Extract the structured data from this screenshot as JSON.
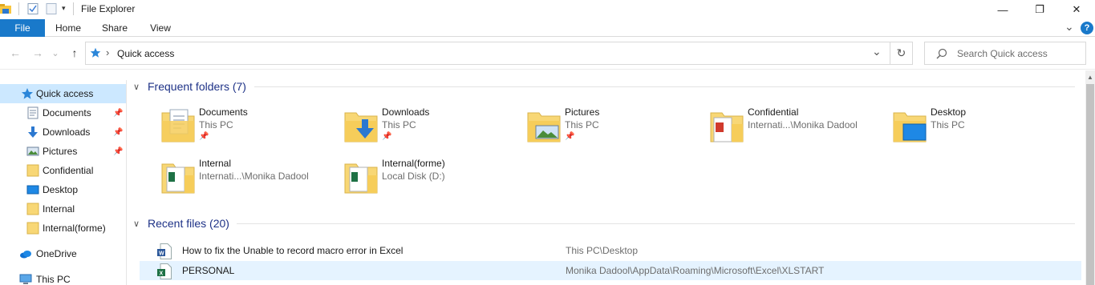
{
  "window": {
    "title": "File Explorer",
    "icons": {
      "app": "file-explorer-icon",
      "properties": "properties-icon",
      "new_folder": "new-folder-icon",
      "customize": "customize-qat-icon"
    },
    "controls": {
      "minimize": "—",
      "restore": "❐",
      "close": "✕"
    }
  },
  "ribbon": {
    "tabs": [
      {
        "label": "File"
      },
      {
        "label": "Home"
      },
      {
        "label": "Share"
      },
      {
        "label": "View"
      }
    ],
    "expand": "⌄",
    "help": "?"
  },
  "nav": {
    "back": "←",
    "forward": "→",
    "recent": "⌄",
    "up": "↑",
    "address_separator": "›",
    "address_text": "Quick access",
    "address_dropdown": "⌄",
    "refresh": "↻",
    "search_placeholder": "Search Quick access"
  },
  "sidebar": {
    "items": [
      {
        "label": "Quick access",
        "icon": "star-icon",
        "pinned": false,
        "selected": true
      },
      {
        "label": "Documents",
        "icon": "documents-folder-icon",
        "pinned": true
      },
      {
        "label": "Downloads",
        "icon": "downloads-icon",
        "pinned": true
      },
      {
        "label": "Pictures",
        "icon": "pictures-icon",
        "pinned": true
      },
      {
        "label": "Confidential",
        "icon": "folder-icon",
        "pinned": false
      },
      {
        "label": "Desktop",
        "icon": "desktop-icon",
        "pinned": false
      },
      {
        "label": "Internal",
        "icon": "folder-icon",
        "pinned": false
      },
      {
        "label": "Internal(forme)",
        "icon": "folder-icon",
        "pinned": false
      },
      {
        "label": "OneDrive",
        "icon": "onedrive-icon",
        "pinned": false
      },
      {
        "label": "This PC",
        "icon": "this-pc-icon",
        "pinned": false
      }
    ]
  },
  "frequent": {
    "heading": "Frequent folders (7)",
    "folders": [
      {
        "name": "Documents",
        "location": "This PC",
        "pinned": true
      },
      {
        "name": "Downloads",
        "location": "This PC",
        "pinned": true
      },
      {
        "name": "Pictures",
        "location": "This PC",
        "pinned": true
      },
      {
        "name": "Confidential",
        "location": "Internati...\\Monika Dadool",
        "pinned": false
      },
      {
        "name": "Desktop",
        "location": "This PC",
        "pinned": false
      },
      {
        "name": "Internal",
        "location": "Internati...\\Monika Dadool",
        "pinned": false
      },
      {
        "name": "Internal(forme)",
        "location": "Local Disk (D:)",
        "pinned": false
      }
    ]
  },
  "recent": {
    "heading": "Recent files (20)",
    "files": [
      {
        "name": "How to fix the Unable to record macro error in Excel",
        "path": "This PC\\Desktop",
        "type": "word"
      },
      {
        "name": "PERSONAL",
        "path": "Monika Dadool\\AppData\\Roaming\\Microsoft\\Excel\\XLSTART",
        "type": "excel"
      }
    ]
  },
  "colors": {
    "accent": "#1979ca",
    "section_heading": "#1e3287",
    "selected_bg": "#cce8ff",
    "folder_yellow": "#f8d775"
  }
}
